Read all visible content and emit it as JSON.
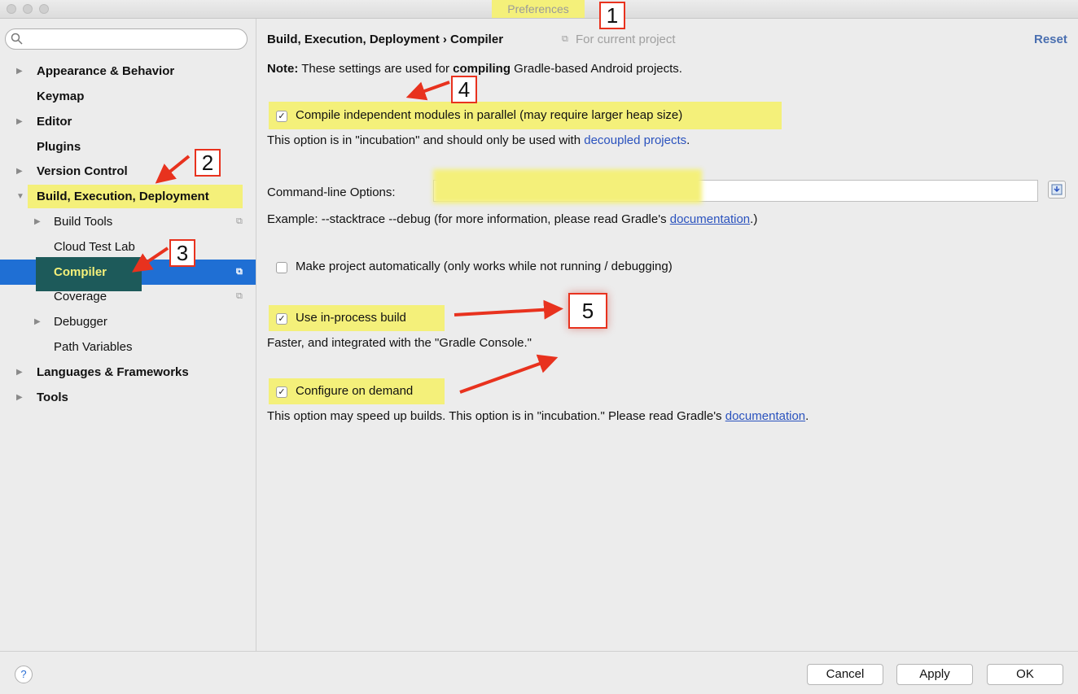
{
  "window": {
    "title": "Preferences"
  },
  "sidebar": {
    "items": [
      {
        "label": "Appearance & Behavior"
      },
      {
        "label": "Keymap"
      },
      {
        "label": "Editor"
      },
      {
        "label": "Plugins"
      },
      {
        "label": "Version Control"
      },
      {
        "label": "Build, Execution, Deployment"
      },
      {
        "label": "Build Tools"
      },
      {
        "label": "Cloud Test Lab"
      },
      {
        "label": "Compiler"
      },
      {
        "label": "Coverage"
      },
      {
        "label": "Debugger"
      },
      {
        "label": "Path Variables"
      },
      {
        "label": "Languages & Frameworks"
      },
      {
        "label": "Tools"
      }
    ]
  },
  "header": {
    "breadcrumb": "Build, Execution, Deployment › Compiler",
    "scope": "For current project",
    "reset_label": "Reset"
  },
  "note": {
    "prefix": "Note:",
    "text1": " These settings are used for ",
    "bold": "compiling",
    "text2": " Gradle-based Android projects."
  },
  "options": {
    "parallel": {
      "label": "Compile independent modules in parallel (may require larger heap size)",
      "checked": true,
      "desc": "This option is in \"incubation\" and should only be used with ",
      "link": "decoupled projects",
      "suffix": "."
    },
    "cmdline": {
      "label": "Command-line Options:",
      "value": "",
      "example_prefix": "Example: --stacktrace --debug (for more information, please read Gradle's ",
      "link": "documentation",
      "example_suffix": ".)"
    },
    "make_auto": {
      "label": "Make project automatically (only works while not running / debugging)",
      "checked": false
    },
    "in_process": {
      "label": "Use in-process build",
      "checked": true,
      "desc": "Faster, and integrated with the \"Gradle Console.\""
    },
    "on_demand": {
      "label": "Configure on demand",
      "checked": true,
      "desc": "This option may speed up builds. This option is in \"incubation.\" Please read Gradle's ",
      "link": "documentation",
      "suffix": "."
    }
  },
  "callouts": [
    "1",
    "2",
    "3",
    "4",
    "5"
  ],
  "footer": {
    "help": "?",
    "cancel": "Cancel",
    "apply": "Apply",
    "ok": "OK"
  },
  "colors": {
    "selection": "#1f6fd4",
    "highlight": "#f4f07a",
    "link": "#2a52be",
    "arrow": "#e8321e"
  },
  "icons": [
    "search-icon",
    "tree-arrow-icon",
    "copy-icon",
    "folder-browse-icon",
    "help-icon",
    "checkmark-icon"
  ]
}
